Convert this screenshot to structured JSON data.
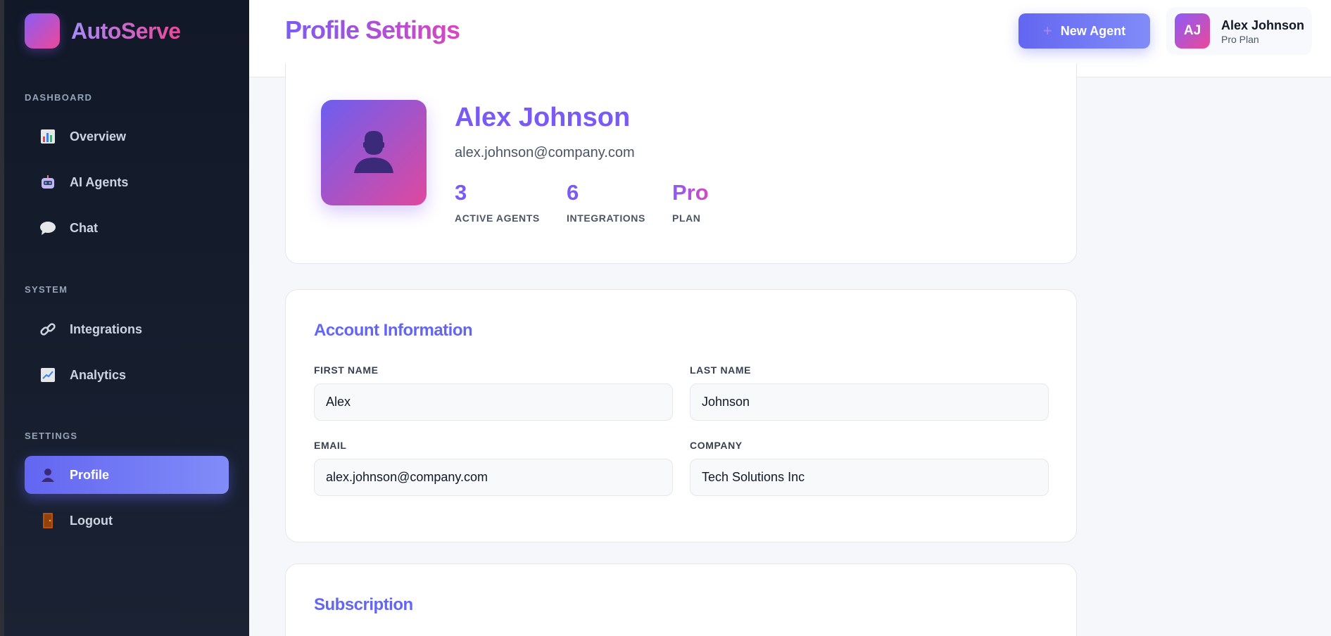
{
  "brand": {
    "name": "AutoServe"
  },
  "sidebar": {
    "sections": [
      {
        "label": "DASHBOARD"
      },
      {
        "label": "SYSTEM"
      },
      {
        "label": "SETTINGS"
      }
    ],
    "items": [
      {
        "label": "Overview",
        "icon": "bar-chart-icon"
      },
      {
        "label": "AI Agents",
        "icon": "robot-icon"
      },
      {
        "label": "Chat",
        "icon": "speech-bubble-icon"
      },
      {
        "label": "Integrations",
        "icon": "link-icon"
      },
      {
        "label": "Analytics",
        "icon": "line-chart-icon"
      },
      {
        "label": "Profile",
        "icon": "user-icon",
        "active": true
      },
      {
        "label": "Logout",
        "icon": "door-icon"
      }
    ]
  },
  "header": {
    "title": "Profile Settings",
    "new_agent_label": "New Agent",
    "user": {
      "initials": "AJ",
      "name": "Alex Johnson",
      "plan": "Pro Plan"
    }
  },
  "profile": {
    "name": "Alex Johnson",
    "email": "alex.johnson@company.com",
    "stats": [
      {
        "value": "3",
        "label": "ACTIVE AGENTS"
      },
      {
        "value": "6",
        "label": "INTEGRATIONS"
      },
      {
        "value": "Pro",
        "label": "PLAN"
      }
    ]
  },
  "account": {
    "title": "Account Information",
    "first_name": {
      "label": "FIRST NAME",
      "value": "Alex"
    },
    "last_name": {
      "label": "LAST NAME",
      "value": "Johnson"
    },
    "email": {
      "label": "EMAIL",
      "value": "alex.johnson@company.com"
    },
    "company": {
      "label": "COMPANY",
      "value": "Tech Solutions Inc"
    }
  },
  "subscription": {
    "title": "Subscription"
  },
  "colors": {
    "accent": "#6366f1",
    "brand_gradient_start": "#8b5cf6",
    "brand_gradient_end": "#ec4899",
    "sidebar_bg": "#111827"
  }
}
